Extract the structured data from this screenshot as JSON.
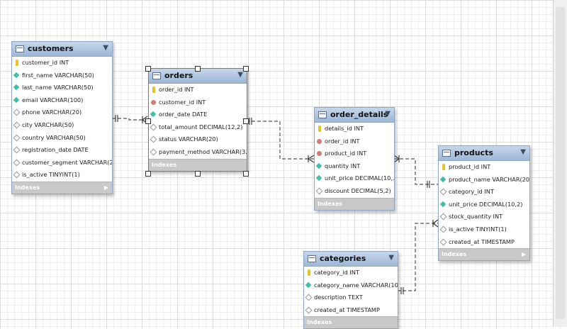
{
  "tables": {
    "customers": {
      "name": "customers",
      "columns": [
        {
          "text": "customer_id INT",
          "icon": "pk"
        },
        {
          "text": "first_name VARCHAR(50)",
          "icon": "nn"
        },
        {
          "text": "last_name VARCHAR(50)",
          "icon": "nn"
        },
        {
          "text": "email VARCHAR(100)",
          "icon": "nn"
        },
        {
          "text": "phone VARCHAR(20)",
          "icon": "nullable"
        },
        {
          "text": "city VARCHAR(50)",
          "icon": "nullable"
        },
        {
          "text": "country VARCHAR(50)",
          "icon": "nullable"
        },
        {
          "text": "registration_date DATE",
          "icon": "nullable"
        },
        {
          "text": "customer_segment VARCHAR(2...",
          "icon": "nullable"
        },
        {
          "text": "is_active TINYINT(1)",
          "icon": "nullable"
        }
      ],
      "indexes_label": "Indexes"
    },
    "orders": {
      "name": "orders",
      "columns": [
        {
          "text": "order_id INT",
          "icon": "pk"
        },
        {
          "text": "customer_id INT",
          "icon": "fk"
        },
        {
          "text": "order_date DATE",
          "icon": "nn"
        },
        {
          "text": "total_amount DECIMAL(12,2)",
          "icon": "nullable"
        },
        {
          "text": "status VARCHAR(20)",
          "icon": "nullable"
        },
        {
          "text": "payment_method VARCHAR(3...",
          "icon": "nullable"
        }
      ],
      "indexes_label": "Indexes"
    },
    "order_details": {
      "name": "order_details",
      "columns": [
        {
          "text": "details_id INT",
          "icon": "pk"
        },
        {
          "text": "order_id INT",
          "icon": "fk"
        },
        {
          "text": "product_id INT",
          "icon": "fk"
        },
        {
          "text": "quantity INT",
          "icon": "nn"
        },
        {
          "text": "unit_price DECIMAL(10,...",
          "icon": "nn"
        },
        {
          "text": "discount DECIMAL(5,2)",
          "icon": "nullable"
        }
      ],
      "indexes_label": "Indexes"
    },
    "products": {
      "name": "products",
      "columns": [
        {
          "text": "product_id INT",
          "icon": "pk"
        },
        {
          "text": "product_name VARCHAR(200)",
          "icon": "nn"
        },
        {
          "text": "category_id INT",
          "icon": "nullable"
        },
        {
          "text": "unit_price DECIMAL(10,2)",
          "icon": "nn"
        },
        {
          "text": "stock_quantity INT",
          "icon": "nullable"
        },
        {
          "text": "is_active TINYINT(1)",
          "icon": "nullable"
        },
        {
          "text": "created_at TIMESTAMP",
          "icon": "nullable"
        }
      ],
      "indexes_label": "Indexes"
    },
    "categories": {
      "name": "categories",
      "columns": [
        {
          "text": "category_id INT",
          "icon": "pk"
        },
        {
          "text": "category_name VARCHAR(10...",
          "icon": "nn"
        },
        {
          "text": "description TEXT",
          "icon": "nullable"
        },
        {
          "text": "created_at TIMESTAMP",
          "icon": "nullable"
        }
      ],
      "indexes_label": "Indexes"
    }
  },
  "relationships": [
    {
      "from": "customers",
      "to": "orders",
      "type": "one-to-many"
    },
    {
      "from": "orders",
      "to": "order_details",
      "type": "one-to-many"
    },
    {
      "from": "products",
      "to": "order_details",
      "type": "one-to-many"
    },
    {
      "from": "categories",
      "to": "products",
      "type": "one-to-many"
    }
  ],
  "colors": {
    "header_top": "#c6d7eb",
    "header_bottom": "#9db7d6",
    "indexes_bar": "#c9c9c9",
    "connector": "#555555"
  }
}
